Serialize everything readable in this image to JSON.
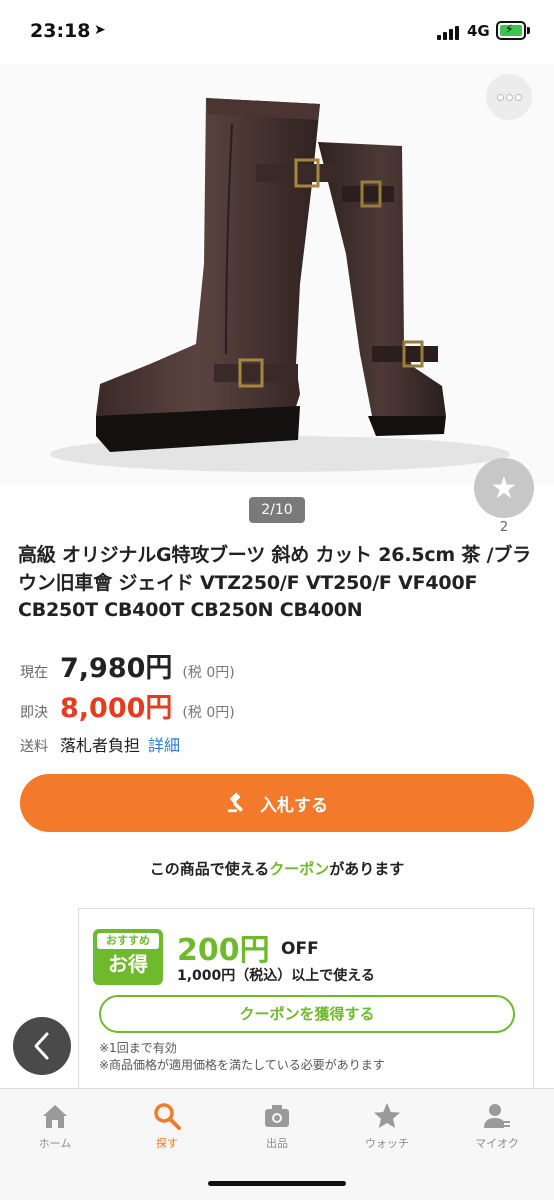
{
  "status_bar": {
    "time": "23:18",
    "network": "4G"
  },
  "gallery": {
    "page_indicator": "2/10",
    "watch_count": "2"
  },
  "item": {
    "title": "高級 オリジナルG特攻ブーツ 斜め カット 26.5cm 茶 /ブラウン旧車會 ジェイド VTZ250/F VT250/F VF400F CB250T CB400T CB250N CB400N"
  },
  "prices": {
    "current_label": "現在",
    "current_value": "7,980円",
    "current_tax": "(税 0円)",
    "buyout_label": "即決",
    "buyout_value": "8,000円",
    "buyout_tax": "(税 0円)"
  },
  "shipping": {
    "label": "送料",
    "value": "落札者負担",
    "detail_link": "詳細"
  },
  "bid_button": {
    "label": "入札する"
  },
  "coupon_note": {
    "prefix": "この商品で使える",
    "highlight": "クーポン",
    "suffix": "があります"
  },
  "coupon": {
    "badge_top": "おすすめ",
    "badge_main": "お得",
    "amount": "200円",
    "off": "OFF",
    "condition": "1,000円（税込）以上で使える",
    "get_button": "クーポンを獲得する",
    "fine_1": "※1回まで有効",
    "fine_2": "※商品価格が適用価格を満たしている必要があります"
  },
  "tabs": [
    {
      "label": "ホーム",
      "icon": "home-icon",
      "active": false
    },
    {
      "label": "探す",
      "icon": "search-icon",
      "active": true
    },
    {
      "label": "出品",
      "icon": "camera-icon",
      "active": false
    },
    {
      "label": "ウォッチ",
      "icon": "star-icon",
      "active": false
    },
    {
      "label": "マイオク",
      "icon": "user-icon",
      "active": false
    }
  ],
  "colors": {
    "accent": "#f37a2a",
    "price_red": "#e63b1f",
    "coupon_green": "#6fba2c",
    "link_blue": "#2a7fd4"
  }
}
